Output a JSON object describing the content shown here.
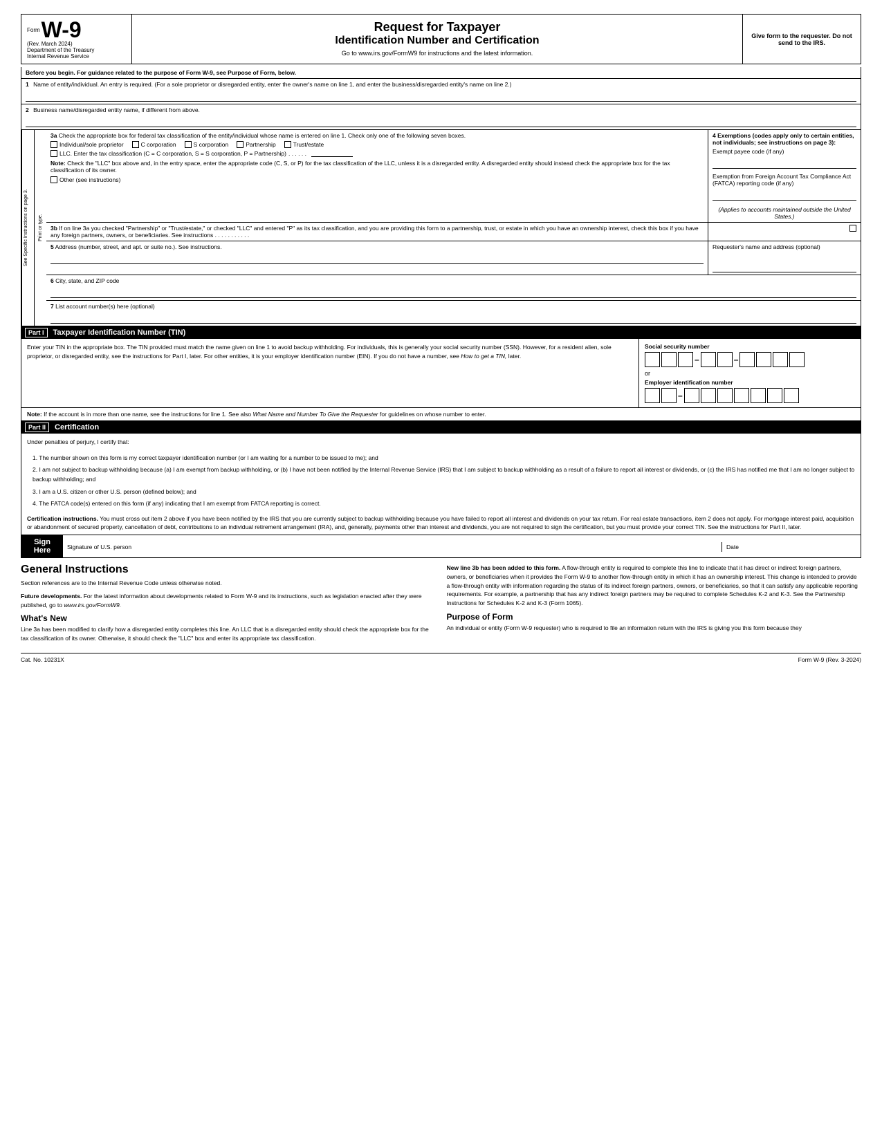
{
  "header": {
    "form_word": "Form",
    "form_number": "W-9",
    "rev": "(Rev. March 2024)",
    "dept": "Department of the Treasury",
    "irs": "Internal Revenue Service",
    "title1": "Request for Taxpayer",
    "title2": "Identification Number and Certification",
    "website": "Go to www.irs.gov/FormW9 for instructions and the latest information.",
    "give_form": "Give form to the requester. Do not send to the IRS."
  },
  "before_begin": {
    "text": "Before you begin. For guidance related to the purpose of Form W-9, see Purpose of Form, below."
  },
  "fields": {
    "field1_num": "1",
    "field1_label": "Name of entity/individual. An entry is required. (For a sole proprietor or disregarded entity, enter the owner's name on line 1, and enter the business/disregarded entity's name on line 2.)",
    "field2_num": "2",
    "field2_label": "Business name/disregarded entity name, if different from above.",
    "field3a_num": "3a",
    "field3a_label": "Check the appropriate box for federal tax classification of the entity/individual whose name is entered on line 1. Check only one of the following seven boxes.",
    "field4_num": "4",
    "field4_label": "Exemptions (codes apply only to certain entities, not individuals; see instructions on page 3):",
    "exempt_payee": "Exempt payee code (if any)",
    "fatca_label": "Exemption from Foreign Account Tax Compliance Act (FATCA) reporting code (if any)",
    "applies_note": "(Applies to accounts maintained outside the United States.)",
    "cb_individual": "Individual/sole proprietor",
    "cb_ccorp": "C corporation",
    "cb_scorp": "S corporation",
    "cb_partnership": "Partnership",
    "cb_trust": "Trust/estate",
    "cb_llc": "LLC. Enter the tax classification (C = C corporation, S = S corporation, P = Partnership)",
    "llc_dots": ". . . . . .",
    "note3a_label": "Note:",
    "note3a_text": "Check the \"LLC\" box above and, in the entry space, enter the appropriate code (C, S, or P) for the tax classification of the LLC, unless it is a disregarded entity. A disregarded entity should instead check the appropriate box for the tax classification of its owner.",
    "cb_other": "Other (see instructions)",
    "field3b_num": "3b",
    "field3b_text": "If on line 3a you checked \"Partnership\" or \"Trust/estate,\" or checked \"LLC\" and entered \"P\" as its tax classification, and you are providing this form to a partnership, trust, or estate in which you have an ownership interest, check this box if you have any foreign partners, owners, or beneficiaries. See instructions",
    "dots3b": ". . . . . . . . . . .",
    "field5_num": "5",
    "field5_label": "Address (number, street, and apt. or suite no.). See instructions.",
    "requester_label": "Requester's name and address (optional)",
    "field6_num": "6",
    "field6_label": "City, state, and ZIP code",
    "field7_num": "7",
    "field7_label": "List account number(s) here (optional)",
    "side_label": "See Specific Instructions on page 3.",
    "side_label2": "Print or type."
  },
  "part1": {
    "label": "Part I",
    "title": "Taxpayer Identification Number (TIN)",
    "tin_text1": "Enter your TIN in the appropriate box. The TIN provided must match the name given on line 1 to avoid backup withholding. For individuals, this is generally your social security number (SSN). However, for a resident alien, sole proprietor, or disregarded entity, see the instructions for Part I, later. For other entities, it is your employer identification number (EIN). If you do not have a number, see",
    "tin_italic": "How to get a TIN,",
    "tin_text2": "later.",
    "ssn_label": "Social security number",
    "or_text": "or",
    "ein_label": "Employer identification number",
    "note_label": "Note:",
    "note_text": "If the account is in more than one name, see the instructions for line 1. See also",
    "note_italic": "What Name and Number To Give the Requester",
    "note_text2": "for guidelines on whose number to enter."
  },
  "part2": {
    "label": "Part II",
    "title": "Certification",
    "under_penalties": "Under penalties of perjury, I certify that:",
    "item1": "1. The number shown on this form is my correct taxpayer identification number (or I am waiting for a number to be issued to me); and",
    "item2": "2. I am not subject to backup withholding because (a) I am exempt from backup withholding, or (b) I have not been notified by the Internal Revenue Service (IRS) that I am subject to backup withholding as a result of a failure to report all interest or dividends, or (c) the IRS has notified me that I am no longer subject to backup withholding; and",
    "item3": "3. I am a U.S. citizen or other U.S. person (defined below); and",
    "item4": "4. The FATCA code(s) entered on this form (if any) indicating that I am exempt from FATCA reporting is correct.",
    "cert_instructions_bold": "Certification instructions.",
    "cert_instructions_text": "You must cross out item 2 above if you have been notified by the IRS that you are currently subject to backup withholding because you have failed to report all interest and dividends on your tax return. For real estate transactions, item 2 does not apply. For mortgage interest paid, acquisition or abandonment of secured property, cancellation of debt, contributions to an individual retirement arrangement (IRA), and, generally, payments other than interest and dividends, you are not required to sign the certification, but you must provide your correct TIN. See the instructions for Part II, later."
  },
  "sign_here": {
    "label_line1": "Sign",
    "label_line2": "Here",
    "signature_label": "Signature of U.S. person",
    "date_label": "Date"
  },
  "general_instructions": {
    "title": "General Instructions",
    "section_refs": "Section references are to the Internal Revenue Code unless otherwise noted.",
    "future_bold": "Future developments.",
    "future_text": "For the latest information about developments related to Form W-9 and its instructions, such as legislation enacted after they were published, go to",
    "future_link": "www.irs.gov/FormW9.",
    "whats_new_title": "What's New",
    "whats_new_text": "Line 3a has been modified to clarify how a disregarded entity completes this line. An LLC that is a disregarded entity should check the appropriate box for the tax classification of its owner. Otherwise, it should check the \"LLC\" box and enter its appropriate tax classification.",
    "right_para1_bold": "New line 3b has been added to this form.",
    "right_para1_text": "A flow-through entity is required to complete this line to indicate that it has direct or indirect foreign partners, owners, or beneficiaries when it provides the Form W-9 to another flow-through entity in which it has an ownership interest. This change is intended to provide a flow-through entity with information regarding the status of its indirect foreign partners, owners, or beneficiaries, so that it can satisfy any applicable reporting requirements. For example, a partnership that has any indirect foreign partners may be required to complete Schedules K-2 and K-3. See the Partnership Instructions for Schedules K-2 and K-3 (Form 1065).",
    "purpose_title": "Purpose of Form",
    "purpose_text": "An individual or entity (Form W-9 requester) who is required to file an information return with the IRS is giving you this form because they"
  },
  "footer": {
    "cat_no": "Cat. No. 10231X",
    "form_ref": "Form W-9 (Rev. 3-2024)"
  }
}
